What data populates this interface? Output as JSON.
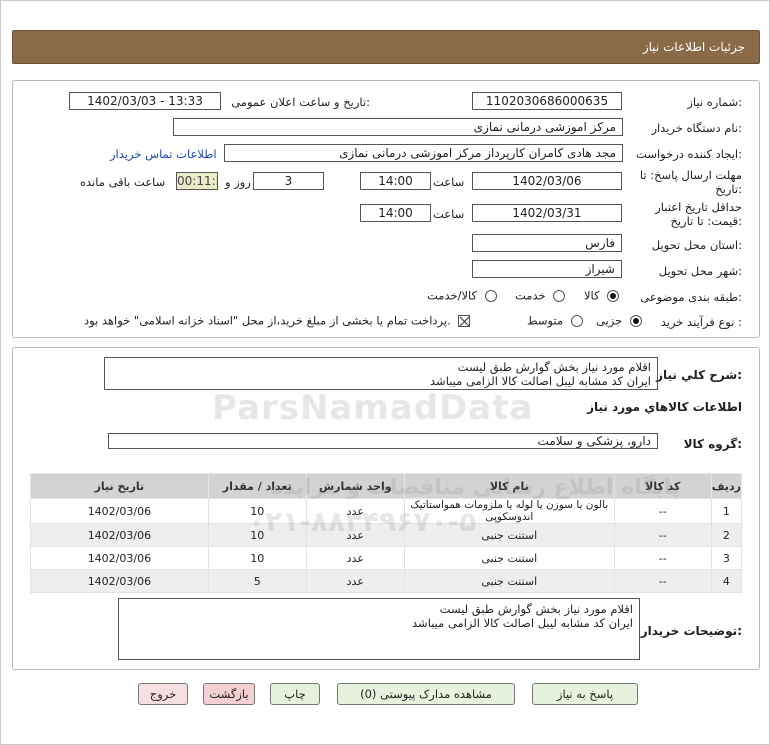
{
  "header": {
    "title": "جزئیات اطلاعات نیاز"
  },
  "form": {
    "need_number": {
      "label": "شماره نیاز:",
      "value": "1102030686000635"
    },
    "announce": {
      "label": "تاریخ و ساعت اعلان عمومی:",
      "value": "1402/03/03 - 13:33"
    },
    "buyer_org": {
      "label": "نام دستگاه خریدار:",
      "value": "مرکز اموزشی درمانی نمازی"
    },
    "requester": {
      "label": "ایجاد کننده درخواست:",
      "value": "مجد هادی کامران کارپرداز مرکز اموزشی درمانی نمازی",
      "contact_link": "اطلاعات تماس خریدار"
    },
    "reply_deadline": {
      "label_line1": "مهلت ارسال پاسخ: تا",
      "label_line2": "تاریخ:",
      "date": "1402/03/06",
      "time_label": "ساعت",
      "time": "14:00",
      "days": "3",
      "days_label": "روز و",
      "remaining": "00:11:50",
      "remaining_label": "ساعت باقی مانده"
    },
    "price_validity": {
      "label_line1": "حداقل تاریخ اعتبار",
      "label_line2": "قیمت: تا تاریخ:",
      "date": "1402/03/31",
      "time_label": "ساعت",
      "time": "14:00"
    },
    "province": {
      "label": "استان محل تحویل:",
      "value": "فارس"
    },
    "city": {
      "label": "شهر محل تحویل:",
      "value": "شیراز"
    },
    "category": {
      "label": "طبقه بندی موضوعی:",
      "options": [
        "کالا",
        "خدمت",
        "کالا/خدمت"
      ],
      "selected": "کالا"
    },
    "process": {
      "label": "نوع فرآیند خرید :",
      "options": [
        "جزیی",
        "متوسط"
      ],
      "selected": "جزیی",
      "payment_note": "پرداخت تمام یا بخشی از مبلغ خرید،از محل \"اسناد خزانه اسلامی\" خواهد بود."
    }
  },
  "summary": {
    "label": "شرح کلي نياز:",
    "line1": "اقلام مورد نیاز بخش گوارش طبق لیست",
    "line2": "ایران کد مشابه لیبل اصالت کالا الزامی میباشد"
  },
  "goods": {
    "section_title": "اطلاعات کالاهاي مورد نياز",
    "group_label": "گروه کالا:",
    "group_value": "دارو، پزشکی و سلامت",
    "columns": [
      "ردیف",
      "کد کالا",
      "نام کالا",
      "واحد شمارش",
      "تعداد / مقدار",
      "تاریخ نیاز"
    ],
    "rows": [
      {
        "row": "1",
        "code": "--",
        "name": "بالون یا سوزن یا لوله یا ملزومات همواستاتیک اندوسکوپی",
        "unit": "عدد",
        "qty": "10",
        "date": "1402/03/06"
      },
      {
        "row": "2",
        "code": "--",
        "name": "استنت جنبی",
        "unit": "عدد",
        "qty": "10",
        "date": "1402/03/06"
      },
      {
        "row": "3",
        "code": "--",
        "name": "استنت جنبی",
        "unit": "عدد",
        "qty": "10",
        "date": "1402/03/06"
      },
      {
        "row": "4",
        "code": "--",
        "name": "استنت جنبی",
        "unit": "عدد",
        "qty": "5",
        "date": "1402/03/06"
      }
    ]
  },
  "buyer_notes": {
    "label": "توضیحات خریدار:",
    "line1": "اقلام مورد نیاز بخش گوارش طبق لیست",
    "line2": "ایران کد مشابه لیبل اصالت کالا الزامی میباشد"
  },
  "buttons": {
    "reply": "پاسخ به نیاز",
    "attachments": "مشاهده مدارک پیوستی (0)",
    "print": "چاپ",
    "back": "بازگشت",
    "exit": "خروج"
  },
  "watermark": {
    "brand": "ParsNamadData",
    "line_fa": "پایگاه اطلاع رسانی مناقصات و مزایده",
    "phone": "۰۲۱-۸۸۳۴۹۶۷۰-۵"
  }
}
